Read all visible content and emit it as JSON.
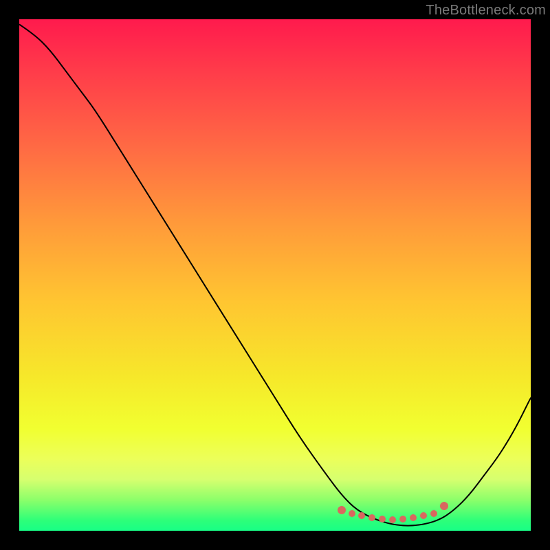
{
  "watermark": "TheBottleneck.com",
  "colors": {
    "curve": "#000000",
    "marker": "#d9685f",
    "frame": "#000000"
  },
  "chart_data": {
    "type": "line",
    "title": "",
    "xlabel": "",
    "ylabel": "",
    "xlim": [
      0,
      100
    ],
    "ylim": [
      0,
      100
    ],
    "curve": {
      "x": [
        0,
        3,
        6,
        9,
        12,
        15,
        20,
        25,
        30,
        35,
        40,
        45,
        50,
        55,
        60,
        63,
        66,
        70,
        74,
        78,
        82,
        85,
        88,
        91,
        94,
        97,
        100
      ],
      "y": [
        99,
        97,
        94,
        90,
        86,
        82,
        74,
        66,
        58,
        50,
        42,
        34,
        26,
        18,
        11,
        7,
        4,
        2,
        1,
        1,
        2,
        4,
        7,
        11,
        15,
        20,
        26
      ]
    },
    "markers": {
      "x": [
        63,
        65,
        67,
        69,
        71,
        73,
        75,
        77,
        79,
        81,
        83
      ],
      "y": [
        4,
        3.4,
        2.9,
        2.5,
        2.3,
        2.2,
        2.3,
        2.5,
        2.9,
        3.4,
        4.9
      ]
    }
  }
}
